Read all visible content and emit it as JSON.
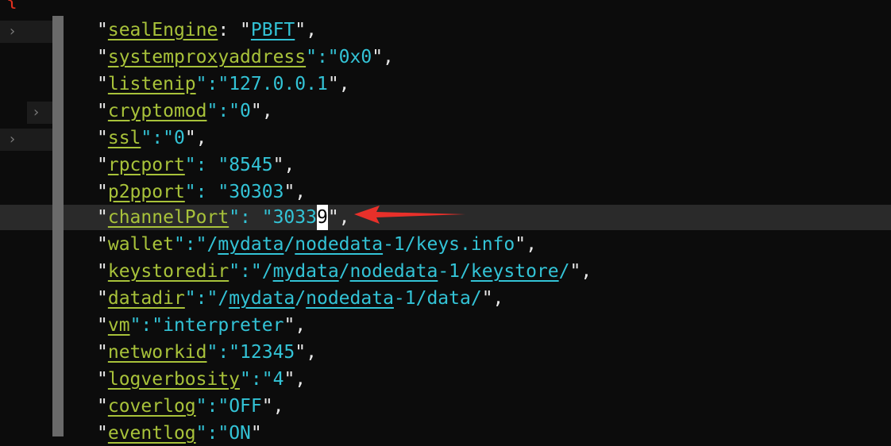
{
  "editor": {
    "open_brace": "{",
    "fold_glyph": "›",
    "lines": [
      {
        "key": "sealEngine",
        "sep": ": \"",
        "value": "PBFT",
        "end": "\","
      },
      {
        "key": "systemproxyaddress",
        "sep": "\":\"",
        "value": "0x0",
        "end": "\","
      },
      {
        "key": "listenip",
        "sep": "\":\"",
        "value": "127.0.0.1",
        "end": "\","
      },
      {
        "key": "cryptomod",
        "sep": "\":\"",
        "value": "0",
        "end": "\","
      },
      {
        "key": "ssl",
        "sep": "\":\"",
        "value": "0",
        "end": "\","
      },
      {
        "key": "rpcport",
        "sep": "\": \"",
        "value": "8545",
        "end": "\","
      },
      {
        "key": "p2pport",
        "sep": "\": \"",
        "value": "30303",
        "end": "\","
      },
      {
        "key": "channelPort",
        "sep": "\": \"",
        "value_before": "3033",
        "value_cursor": "9",
        "end": "\","
      },
      {
        "key": "wallet",
        "sep": "\":\"/",
        "v1": "mydata",
        "s1": "/",
        "v2": "nodedata",
        "s2": "-1/keys.info",
        "end": "\","
      },
      {
        "key": "keystoredir",
        "sep": "\":\"/",
        "v1": "mydata",
        "s1": "/",
        "v2": "nodedata",
        "s2": "-1/",
        "v3": "keystore",
        "s3": "/",
        "end": "\","
      },
      {
        "key": "datadir",
        "sep": "\":\"/",
        "v1": "mydata",
        "s1": "/",
        "v2": "nodedata",
        "s2": "-1/data/",
        "end": "\","
      },
      {
        "key": "vm",
        "sep": "\":\"",
        "value": "interpreter",
        "end": "\","
      },
      {
        "key": "networkid",
        "sep": "\":\"",
        "value": "12345",
        "end": "\","
      },
      {
        "key": "logverbosity",
        "sep": "\":\"",
        "value": "4",
        "end": "\","
      },
      {
        "key": "coverlog",
        "sep": "\":\"",
        "value": "OFF",
        "end": "\","
      },
      {
        "key": "eventlog",
        "sep": "\":\"",
        "value": "ON",
        "end": "\""
      }
    ]
  }
}
